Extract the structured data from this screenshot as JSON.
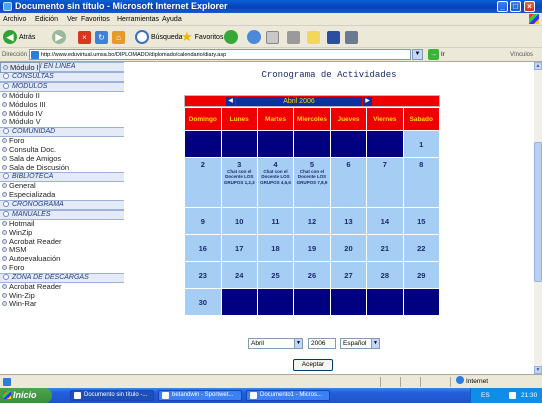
{
  "window": {
    "title": "Documento sin título - Microsoft Internet Explorer",
    "buttons": {
      "minimize": "_",
      "maximize": "□",
      "close": "×"
    }
  },
  "menu": [
    "Archivo",
    "Edición",
    "Ver",
    "Favoritos",
    "Herramientas",
    "Ayuda"
  ],
  "toolbar": {
    "back": "Atrás",
    "search": "Búsqueda",
    "favorites": "Favoritos",
    "back_glyph": "◀",
    "forward_glyph": "▶",
    "stop_glyph": "×",
    "refresh_glyph": "↻",
    "home_glyph": "⌂"
  },
  "address": {
    "label": "Dirección",
    "url": "http://www.eduvirtual.umsa.bo/DIPLOMADO/diplomado/calendario/diary.asp",
    "go_label": "Ir",
    "links_label": "Vínculos"
  },
  "sidebar": {
    "sections": [
      {
        "title": "EXAMEN EN LINEA",
        "items": []
      },
      {
        "title": "CONSULTAS",
        "items": []
      },
      {
        "title": "MÓDULOS",
        "items": [
          "Módulo I",
          "Módulo II",
          "Módulos III",
          "Módulo IV",
          "Módulo V"
        ]
      },
      {
        "title": "COMUNIDAD",
        "items": [
          "Foro",
          "Consulta Doc.",
          "Sala de Amigos",
          "Sala de Discusión"
        ]
      },
      {
        "title": "BIBLIOTECA",
        "items": [
          "General",
          "Especializada"
        ]
      },
      {
        "title": "CRONOGRAMA",
        "items": []
      },
      {
        "title": "MANUALES",
        "items": [
          "Hotmail",
          "WinZip",
          "Acrobat Reader",
          "MSM",
          "Autoevaluación",
          "Foro"
        ]
      },
      {
        "title": "ZONA DE DESCARGAS",
        "items": [
          "Acrobat Reader",
          "Win-Zip",
          "Win-Rar"
        ]
      }
    ]
  },
  "page": {
    "title": "Cronograma de Actividades"
  },
  "calendar": {
    "prev": "◀",
    "next": "▶",
    "month_label": "Abril 2006",
    "weekdays": [
      "Domingo",
      "Lunes",
      "Martes",
      "Miercoles",
      "Jueves",
      "Viernes",
      "Sabado"
    ],
    "weeks": [
      [
        null,
        null,
        null,
        null,
        null,
        null,
        {
          "day": "1"
        }
      ],
      [
        {
          "day": "2"
        },
        {
          "day": "3",
          "event": "Chat con el Docente LOS GRUPOS 1,2,3"
        },
        {
          "day": "4",
          "event": "Chat con el Docente LOS GRUPOS 4,5,6"
        },
        {
          "day": "5",
          "event": "Chat con el Docente LOS GRUPOS 7,8,9"
        },
        {
          "day": "6"
        },
        {
          "day": "7"
        },
        {
          "day": "8"
        }
      ],
      [
        {
          "day": "9"
        },
        {
          "day": "10"
        },
        {
          "day": "11"
        },
        {
          "day": "12"
        },
        {
          "day": "13"
        },
        {
          "day": "14"
        },
        {
          "day": "15"
        }
      ],
      [
        {
          "day": "16"
        },
        {
          "day": "17"
        },
        {
          "day": "18"
        },
        {
          "day": "19"
        },
        {
          "day": "20"
        },
        {
          "day": "21"
        },
        {
          "day": "22"
        }
      ],
      [
        {
          "day": "23"
        },
        {
          "day": "24"
        },
        {
          "day": "25"
        },
        {
          "day": "26"
        },
        {
          "day": "27"
        },
        {
          "day": "28"
        },
        {
          "day": "29"
        }
      ],
      [
        {
          "day": "30"
        },
        null,
        null,
        null,
        null,
        null,
        null
      ]
    ],
    "colors": {
      "header": "#ef0000",
      "weekday_text": "#ffd800",
      "day_cell": "#a6cdf3",
      "empty_cell": "#000080"
    }
  },
  "controls": {
    "month_value": "Abril",
    "year_value": "2006",
    "language_value": "Español",
    "submit": "Aceptar"
  },
  "status": {
    "zone": "Internet"
  },
  "taskbar": {
    "start": "Inicio",
    "tasks": [
      "Documento sin título -...",
      "betandwin - Sportwet...",
      "Documento1 - Micros..."
    ],
    "lang": "ES",
    "clock": "21:30"
  }
}
